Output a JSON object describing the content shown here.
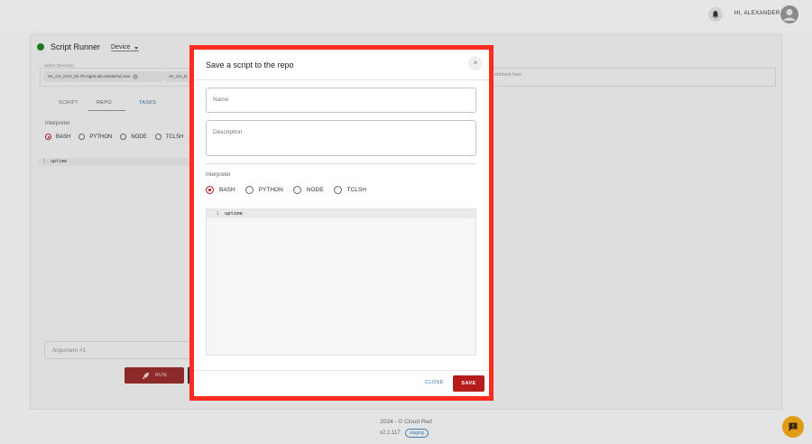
{
  "header": {
    "greeting": "HI, ALEXANDER",
    "icons": {
      "notifications": "bell-icon",
      "avatar": "user-avatar-icon"
    }
  },
  "runner": {
    "title": "Script Runner",
    "device_mode": "Device",
    "selected_devices_label": "Select Device(s)",
    "chips": [
      "VA_CH_CHV_01-7b-mgmt.lab.ravlabchd.com",
      "VA_CH_D"
    ],
    "extra_text": "rdrtment here",
    "tabs": [
      "SCRIPT",
      "REPO",
      "TASKS"
    ],
    "interpreter_label": "Interpreter",
    "interpreters": [
      "BASH",
      "PYTHON",
      "NODE",
      "TCLSH"
    ],
    "selected_interpreter": "BASH",
    "code": {
      "line_number": "1",
      "text": "uptime"
    },
    "argument_placeholder": "Argument #1",
    "run_label": "RUN"
  },
  "modal": {
    "title": "Save a script to the repo",
    "close_symbol": "×",
    "name_placeholder": "Name",
    "description_placeholder": "Description",
    "interpreter_label": "Interpreter",
    "interpreters": [
      "BASH",
      "PYTHON",
      "NODE",
      "TCLSH"
    ],
    "selected_interpreter": "BASH",
    "code": {
      "line_number": "1",
      "text": "uptime"
    },
    "close_label": "CLOSE",
    "save_label": "SAVE",
    "highlight_color": "#ff2b1f",
    "accent_color": "#b71c1c"
  },
  "footer": {
    "copyright": "2024 - © Cloud Red",
    "version": "v2.1.117",
    "badge": "staging"
  }
}
